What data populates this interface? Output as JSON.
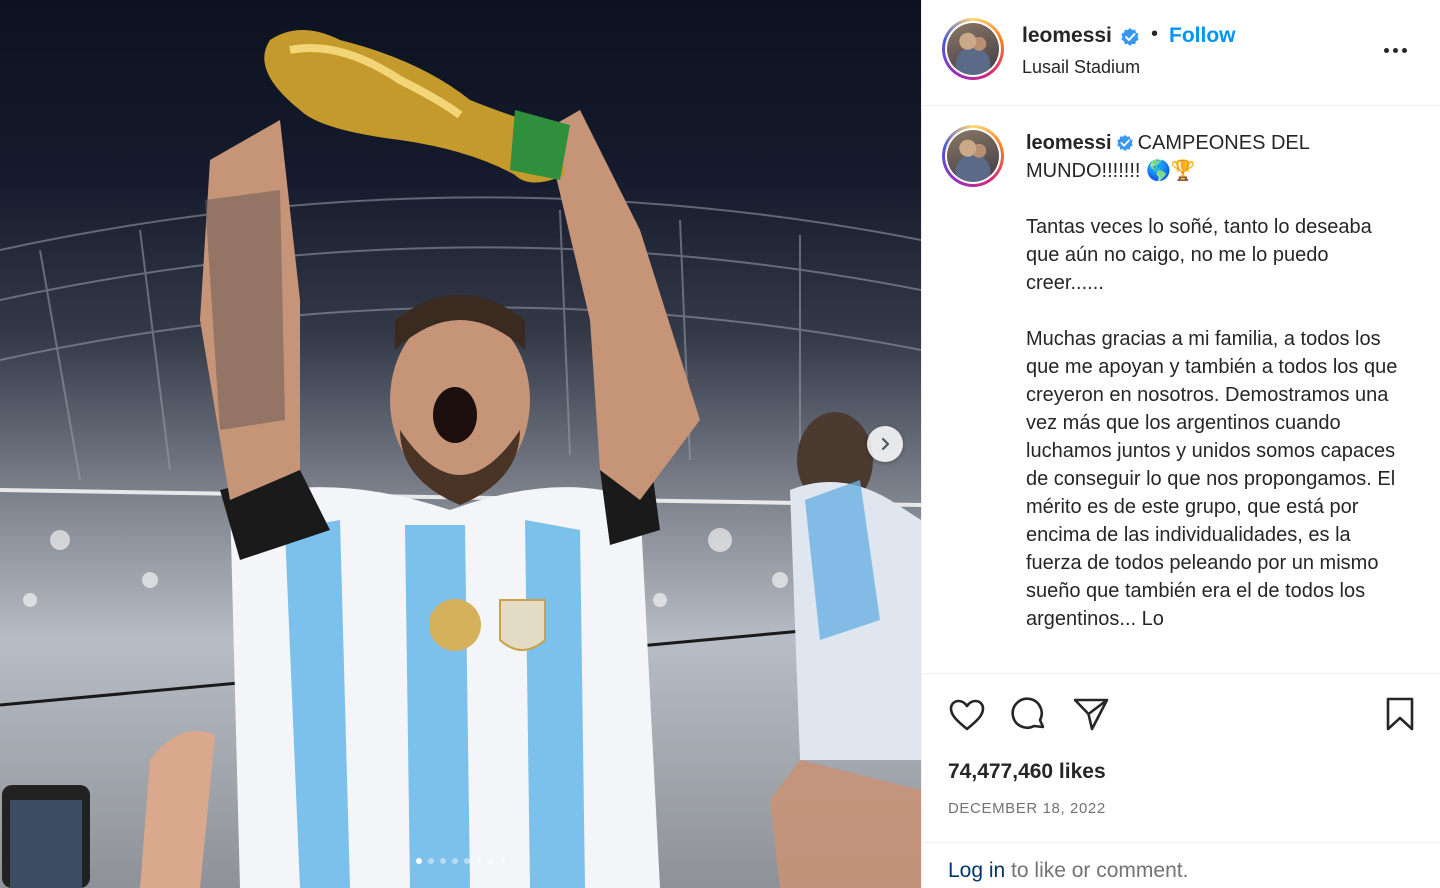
{
  "post": {
    "username": "leomessi",
    "follow_label": "Follow",
    "separator": "•",
    "location": "Lusail Stadium",
    "caption_heading": "CAMPEONES DEL MUNDO!!!!!!! 🌎🏆",
    "caption_body": "Tantas veces lo soñé, tanto lo deseaba que aún no caigo, no me lo puedo creer......\n\nMuchas gracias a mi familia, a todos los que me apoyan y también a todos los que creyeron en nosotros. Demostramos una vez más que los argentinos cuando luchamos juntos y unidos somos capaces de conseguir lo que nos propongamos. El mérito es de este grupo, que está por encima de las individualidades, es la fuerza de todos peleando por un mismo sueño que también era el de todos los argentinos... Lo",
    "likes": "74,477,460 likes",
    "date": "DECEMBER 18, 2022",
    "login_link": "Log in",
    "login_rest": " to like or comment."
  },
  "icons": {
    "verified": "verified-badge-icon",
    "more": "more-options-icon",
    "like": "heart-icon",
    "comment": "comment-icon",
    "share": "share-icon",
    "save": "bookmark-icon",
    "next": "chevron-right-icon"
  },
  "carousel": {
    "slide_count": 8,
    "active_index": 0
  },
  "colors": {
    "follow": "#0095f6",
    "verified": "#3897f0",
    "link": "#00376b",
    "muted": "#737373"
  }
}
